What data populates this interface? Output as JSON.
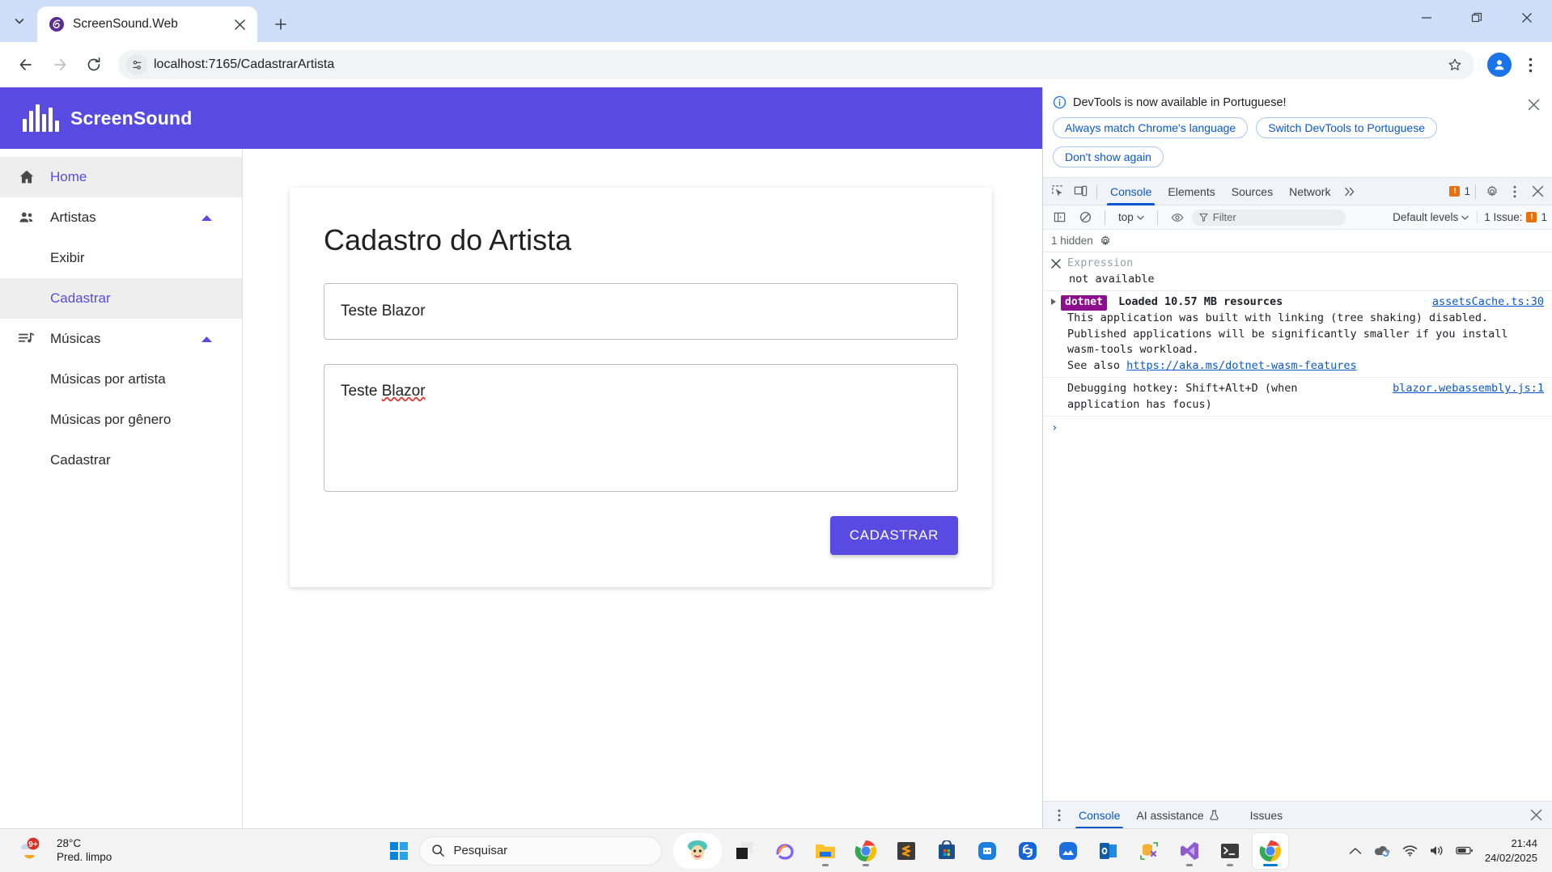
{
  "browser": {
    "tab": {
      "title": "ScreenSound.Web",
      "favicon": "blazor-icon",
      "close_icon": "close-icon"
    },
    "new_tab_icon": "plus-icon",
    "tab_list_icon": "chevron-down-icon",
    "window_controls": {
      "minimize": "minimize-icon",
      "restore": "restore-icon",
      "close": "close-icon"
    },
    "nav": {
      "back": "back-arrow-icon",
      "forward": "forward-arrow-icon",
      "reload": "reload-icon"
    },
    "omnibox": {
      "site_info_icon": "tune-icon",
      "url": "localhost:7165/CadastrarArtista",
      "bookmark_icon": "star-icon"
    },
    "profile_icon": "account-icon",
    "menu_icon": "kebab-menu-icon"
  },
  "app": {
    "header": {
      "logo_icon": "soundwave-icon",
      "brand": "ScreenSound"
    },
    "sidebar": {
      "items": [
        {
          "label": "Home",
          "icon": "home-icon",
          "active": true,
          "sub": false
        },
        {
          "label": "Artistas",
          "icon": "people-icon",
          "active": false,
          "sub": false,
          "caret": "caret-up-icon"
        },
        {
          "label": "Exibir",
          "icon": "",
          "active": false,
          "sub": true
        },
        {
          "label": "Cadastrar",
          "icon": "",
          "active": true,
          "sub": true
        },
        {
          "label": "Músicas",
          "icon": "playlist-icon",
          "active": false,
          "sub": false,
          "caret": "caret-up-icon"
        },
        {
          "label": "Músicas por artista",
          "icon": "",
          "active": false,
          "sub": true
        },
        {
          "label": "Músicas por gênero",
          "icon": "",
          "active": false,
          "sub": true
        },
        {
          "label": "Cadastrar",
          "icon": "",
          "active": false,
          "sub": true
        }
      ]
    },
    "form": {
      "title": "Cadastro do Artista",
      "name_value": "Teste Blazor",
      "name_placeholder": "",
      "bio_value_prefix": "Teste ",
      "bio_value_misspelled": "Blazor",
      "bio_placeholder": "",
      "submit_label": "CADASTRAR"
    },
    "colors": {
      "primary": "#594AE2",
      "link": "#594AE2"
    }
  },
  "devtools": {
    "banner": {
      "info_icon": "info-icon",
      "message": "DevTools is now available in Portuguese!",
      "buttons": [
        "Always match Chrome's language",
        "Switch DevTools to Portuguese",
        "Don't show again"
      ],
      "close_icon": "close-icon"
    },
    "toolbar": {
      "inspect_icon": "inspect-element-icon",
      "device_icon": "device-toolbar-icon",
      "tabs": [
        {
          "label": "Console",
          "active": true
        },
        {
          "label": "Elements",
          "active": false
        },
        {
          "label": "Sources",
          "active": false
        },
        {
          "label": "Network",
          "active": false
        }
      ],
      "more_tabs_icon": "chevron-double-right-icon",
      "error_count": "1",
      "settings_icon": "gear-icon",
      "more_icon": "kebab-menu-icon",
      "close_icon": "close-icon"
    },
    "filterbar": {
      "sidebar_icon": "console-sidebar-icon",
      "clear_icon": "clear-console-icon",
      "context": "top",
      "eye_icon": "live-expression-icon",
      "filter_icon": "filter-icon",
      "filter_placeholder": "Filter",
      "levels": "Default levels",
      "issues_label": "1 Issue:",
      "issues_count": "1"
    },
    "hidden_row": {
      "label": "1 hidden",
      "settings_icon": "gear-icon"
    },
    "console": {
      "expression": {
        "close_icon": "close-icon",
        "label": "Expression",
        "value": "not available"
      },
      "messages": [
        {
          "expand_icon": "triangle-right-icon",
          "badge": "dotnet",
          "title": "Loaded 10.57 MB resources",
          "source": "assetsCache.ts:30",
          "lines": [
            "This application was built with linking (tree shaking) disabled.",
            "Published applications will be significantly smaller if you install",
            "wasm-tools workload."
          ],
          "see_also_prefix": "See also ",
          "see_also_link": "https://aka.ms/dotnet-wasm-features"
        },
        {
          "text_line1": "Debugging hotkey: Shift+Alt+D (when",
          "text_line2": "application has focus)",
          "source": "blazor.webassembly.js:1"
        }
      ],
      "prompt_icon": "chevron-right-icon"
    },
    "drawer": {
      "more_icon": "kebab-menu-icon",
      "tabs": [
        {
          "label": "Console",
          "active": true
        },
        {
          "label": "AI assistance",
          "active": false,
          "icon": "flask-icon"
        },
        {
          "label": "Issues",
          "active": false
        }
      ],
      "close_icon": "close-icon"
    }
  },
  "taskbar": {
    "weather": {
      "temp": "28°C",
      "condition": "Pred. limpo",
      "badge": "9+",
      "icon": "weather-sun-cloud-icon"
    },
    "start_icon": "windows-start-icon",
    "search_placeholder": "Pesquisar",
    "search_icon": "search-icon",
    "apps": [
      {
        "name": "carnival-mask-icon",
        "pinned": true
      },
      {
        "name": "layers-app-icon"
      },
      {
        "name": "copilot-icon"
      },
      {
        "name": "file-explorer-icon",
        "running": true
      },
      {
        "name": "chrome-icon",
        "running": true
      },
      {
        "name": "sublime-text-icon"
      },
      {
        "name": "microsoft-store-icon"
      },
      {
        "name": "blue-grid-app-icon"
      },
      {
        "name": "blue-swirl-app-icon"
      },
      {
        "name": "blue-photos-app-icon"
      },
      {
        "name": "outlook-icon"
      },
      {
        "name": "sql-tools-icon"
      },
      {
        "name": "visual-studio-icon",
        "running": true
      },
      {
        "name": "terminal-icon",
        "running": true
      },
      {
        "name": "chrome-icon-active",
        "active": true
      }
    ],
    "tray": {
      "chevron_icon": "chevron-up-icon",
      "onedrive_icon": "onedrive-icon",
      "wifi_icon": "wifi-icon",
      "volume_icon": "volume-icon",
      "battery_icon": "battery-icon"
    },
    "clock": {
      "time": "21:44",
      "date": "24/02/2025"
    }
  }
}
